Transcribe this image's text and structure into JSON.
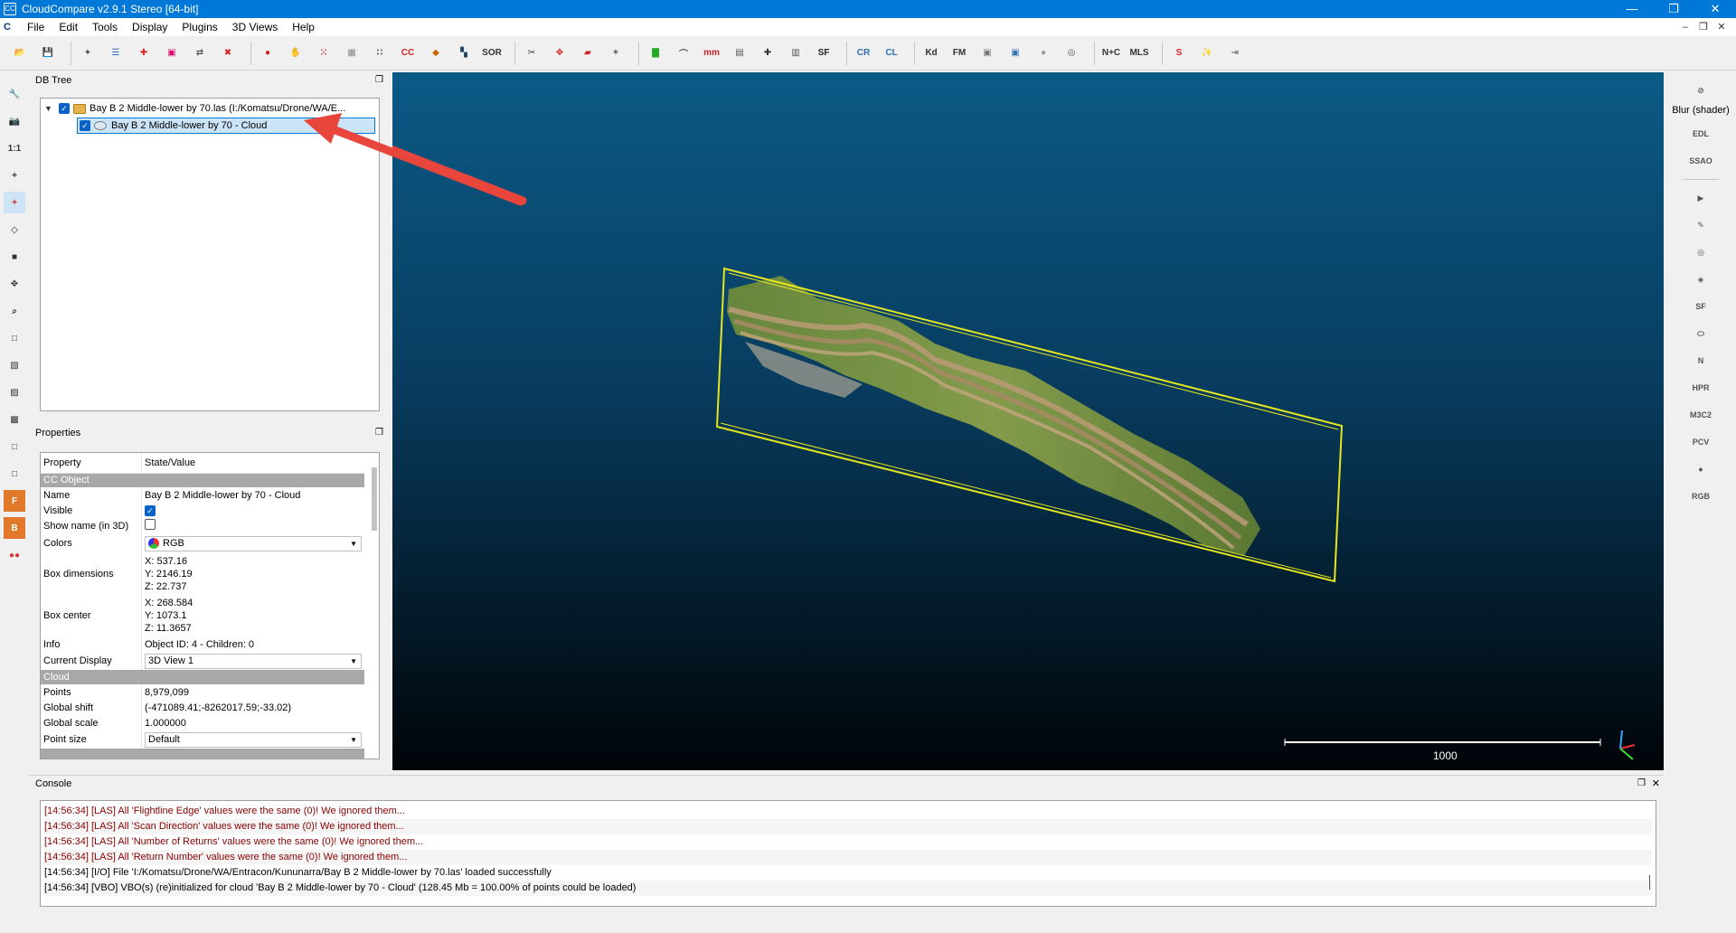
{
  "window": {
    "title": "CloudCompare v2.9.1 Stereo [64-bit]",
    "app_icon_label": "CC",
    "minimize": "—",
    "maximize": "❐",
    "close": "✕"
  },
  "menu": {
    "logo": "C",
    "items": [
      "File",
      "Edit",
      "Tools",
      "Display",
      "Plugins",
      "3D Views",
      "Help"
    ],
    "mdi": [
      "–",
      "❐",
      "✕"
    ]
  },
  "toolbar": {
    "icons": [
      {
        "name": "open-icon",
        "glyph": "📂",
        "color": "#2e6fb5"
      },
      {
        "name": "save-icon",
        "glyph": "💾",
        "color": "#2e6fb5"
      },
      {
        "name": "sep"
      },
      {
        "name": "clone-icon",
        "glyph": "✦",
        "color": "#555"
      },
      {
        "name": "list-icon",
        "glyph": "☰",
        "color": "#2e6fb5"
      },
      {
        "name": "add-point-icon",
        "glyph": "✚",
        "color": "#d22"
      },
      {
        "name": "color-icon",
        "glyph": "▣",
        "color": "#d06"
      },
      {
        "name": "merge-icon",
        "glyph": "⇄",
        "color": "#555"
      },
      {
        "name": "delete-icon",
        "glyph": "✖",
        "color": "#d22"
      },
      {
        "name": "sep"
      },
      {
        "name": "registration-icon",
        "glyph": "●",
        "color": "#c22"
      },
      {
        "name": "segment-icon",
        "glyph": "✋",
        "color": "#777"
      },
      {
        "name": "sample-icon",
        "glyph": "⁙",
        "color": "#c22"
      },
      {
        "name": "subsample-icon",
        "glyph": "▦",
        "color": "#888"
      },
      {
        "name": "scatter-icon",
        "glyph": "∷",
        "color": "#666"
      },
      {
        "name": "cc-icon",
        "glyph": "CC",
        "color": "#d22"
      },
      {
        "name": "cloud-noise-icon",
        "glyph": "◆",
        "color": "#c60"
      },
      {
        "name": "checker-icon",
        "glyph": "▚",
        "color": "#246"
      },
      {
        "name": "sor-icon",
        "glyph": "SOR",
        "color": "#333"
      },
      {
        "name": "sep"
      },
      {
        "name": "scissors-icon",
        "glyph": "✂",
        "color": "#333"
      },
      {
        "name": "translate-icon",
        "glyph": "✥",
        "color": "#c22"
      },
      {
        "name": "plane-icon",
        "glyph": "▰",
        "color": "#c22"
      },
      {
        "name": "pick-icon",
        "glyph": "✶",
        "color": "#555"
      },
      {
        "name": "sep"
      },
      {
        "name": "histogram-icon",
        "glyph": "▇",
        "color": "#2a2"
      },
      {
        "name": "curve-icon",
        "glyph": "⌒",
        "color": "#555"
      },
      {
        "name": "minmax-icon",
        "glyph": "mm",
        "color": "#c22"
      },
      {
        "name": "calendar-icon",
        "glyph": "▤",
        "color": "#555"
      },
      {
        "name": "plus-icon",
        "glyph": "✚",
        "color": "#333"
      },
      {
        "name": "calculator-icon",
        "glyph": "▥",
        "color": "#555"
      },
      {
        "name": "sf-icon",
        "glyph": "SF",
        "color": "#222"
      },
      {
        "name": "sep"
      },
      {
        "name": "canupo-create-icon",
        "glyph": "CR",
        "color": "#2e6fb5"
      },
      {
        "name": "canupo-classify-icon",
        "glyph": "CL",
        "color": "#2e6fb5"
      },
      {
        "name": "sep"
      },
      {
        "name": "kd-icon",
        "glyph": "Kd",
        "color": "#333"
      },
      {
        "name": "fm-icon",
        "glyph": "FM",
        "color": "#333"
      },
      {
        "name": "box-icon",
        "glyph": "▣",
        "color": "#777"
      },
      {
        "name": "photo-icon",
        "glyph": "▣",
        "color": "#2e6fb5"
      },
      {
        "name": "sphere-icon",
        "glyph": "●",
        "color": "#999"
      },
      {
        "name": "globe-icon",
        "glyph": "◎",
        "color": "#555"
      },
      {
        "name": "sep"
      },
      {
        "name": "n-c-icon",
        "glyph": "N+C",
        "color": "#333"
      },
      {
        "name": "mls-icon",
        "glyph": "MLS",
        "color": "#333"
      },
      {
        "name": "sep"
      },
      {
        "name": "spline-icon",
        "glyph": "S",
        "color": "#d22"
      },
      {
        "name": "wand-icon",
        "glyph": "✨",
        "color": "#777"
      },
      {
        "name": "export-icon",
        "glyph": "⇥",
        "color": "#777"
      }
    ]
  },
  "left_toolbar": {
    "icons": [
      {
        "name": "wrench-icon",
        "glyph": "🔧"
      },
      {
        "name": "camera-icon",
        "glyph": "📷"
      },
      {
        "name": "zoom-1to1-icon",
        "glyph": "1:1"
      },
      {
        "name": "pivot-icon",
        "glyph": "+"
      },
      {
        "name": "auto-pivot-icon",
        "glyph": "+"
      },
      {
        "name": "rotate-icon",
        "glyph": "◇"
      },
      {
        "name": "cube-perspective-icon",
        "glyph": "■"
      },
      {
        "name": "move-icon",
        "glyph": "✥"
      },
      {
        "name": "zoom-icon",
        "glyph": "⌕"
      },
      {
        "name": "view-top-icon",
        "glyph": "□"
      },
      {
        "name": "view-front-icon",
        "glyph": "▧"
      },
      {
        "name": "view-left-icon",
        "glyph": "▨"
      },
      {
        "name": "view-back-icon",
        "glyph": "▩"
      },
      {
        "name": "view-right-icon",
        "glyph": "□"
      },
      {
        "name": "view-bottom-icon",
        "glyph": "□"
      },
      {
        "name": "front-iso-icon",
        "glyph": "F"
      },
      {
        "name": "back-iso-icon",
        "glyph": "B"
      },
      {
        "name": "stereo-icon",
        "glyph": "●●"
      }
    ]
  },
  "db_tree": {
    "title": "DB Tree",
    "float_glyph": "❐",
    "check_glyph": "✓",
    "expander_glyph": "▼",
    "root_label": "Bay B 2 Middle-lower by 70.las (I:/Komatsu/Drone/WA/E...",
    "child_label": "Bay B 2 Middle-lower by 70 - Cloud"
  },
  "properties": {
    "title": "Properties",
    "float_glyph": "❐",
    "col_property": "Property",
    "col_value": "State/Value",
    "section_cc_object": "CC Object",
    "section_cloud": "Cloud",
    "name_label": "Name",
    "name_value": "Bay B 2 Middle-lower by 70 - Cloud",
    "visible_label": "Visible",
    "show_name_label": "Show name (in 3D)",
    "colors_label": "Colors",
    "colors_value": "RGB",
    "box_dim_label": "Box dimensions",
    "box_dim": [
      "X: 537.16",
      "Y: 2146.19",
      "Z: 22.737"
    ],
    "box_center_label": "Box center",
    "box_center": [
      "X: 268.584",
      "Y: 1073.1",
      "Z: 11.3657"
    ],
    "info_label": "Info",
    "info_value": "Object ID: 4 - Children: 0",
    "current_display_label": "Current Display",
    "current_display_value": "3D View 1",
    "points_label": "Points",
    "points_value": "8,979,099",
    "global_shift_label": "Global shift",
    "global_shift_value": "(-471089.41;-8262017.59;-33.02)",
    "global_scale_label": "Global scale",
    "global_scale_value": "1.000000",
    "point_size_label": "Point size",
    "point_size_value": "Default",
    "dropdown_arrow": "▼"
  },
  "view3d": {
    "scale_label": "1000",
    "bbox_color": "#e6e61e",
    "arrow_color": "#e8453c"
  },
  "right_toolbar": {
    "blur_label": "Blur (shader)",
    "icons": [
      {
        "name": "blur-icon",
        "glyph": "⊘"
      },
      {
        "name": "edl-icon",
        "glyph": "EDL"
      },
      {
        "name": "ssao-icon",
        "glyph": "SSAO"
      },
      {
        "name": "sep"
      },
      {
        "name": "animation-icon",
        "glyph": "▶"
      },
      {
        "name": "brush-icon",
        "glyph": "✎"
      },
      {
        "name": "compass-icon",
        "glyph": "◎"
      },
      {
        "name": "shield-icon",
        "glyph": "◈"
      },
      {
        "name": "sf-sphere-icon",
        "glyph": "SF"
      },
      {
        "name": "ellipse-icon",
        "glyph": "⬭"
      },
      {
        "name": "north-icon",
        "glyph": "N"
      },
      {
        "name": "hpr-icon",
        "glyph": "HPR"
      },
      {
        "name": "m3c2-icon",
        "glyph": "M3C2"
      },
      {
        "name": "pcv-icon",
        "glyph": "PCV"
      },
      {
        "name": "sphere-green-icon",
        "glyph": "●"
      },
      {
        "name": "rgb-icon",
        "glyph": "RGB"
      }
    ]
  },
  "console": {
    "title": "Console",
    "float_glyph": "❐",
    "close_glyph": "✕",
    "lines": [
      {
        "type": "warn",
        "text": "[14:56:34] [LAS] All 'Flightline Edge' values were the same (0)! We ignored them..."
      },
      {
        "type": "warn",
        "text": "[14:56:34] [LAS] All 'Scan Direction' values were the same (0)! We ignored them..."
      },
      {
        "type": "warn",
        "text": "[14:56:34] [LAS] All 'Number of Returns' values were the same (0)! We ignored them..."
      },
      {
        "type": "warn",
        "text": "[14:56:34] [LAS] All 'Return Number' values were the same (0)! We ignored them..."
      },
      {
        "type": "info",
        "text": "[14:56:34] [I/O] File 'I:/Komatsu/Drone/WA/Entracon/Kununarra/Bay B 2 Middle-lower by 70.las' loaded successfully"
      },
      {
        "type": "info",
        "text": "[14:56:34] [VBO] VBO(s) (re)initialized for cloud 'Bay B 2 Middle-lower by 70 - Cloud' (128.45 Mb = 100.00% of points could be loaded)"
      }
    ]
  }
}
